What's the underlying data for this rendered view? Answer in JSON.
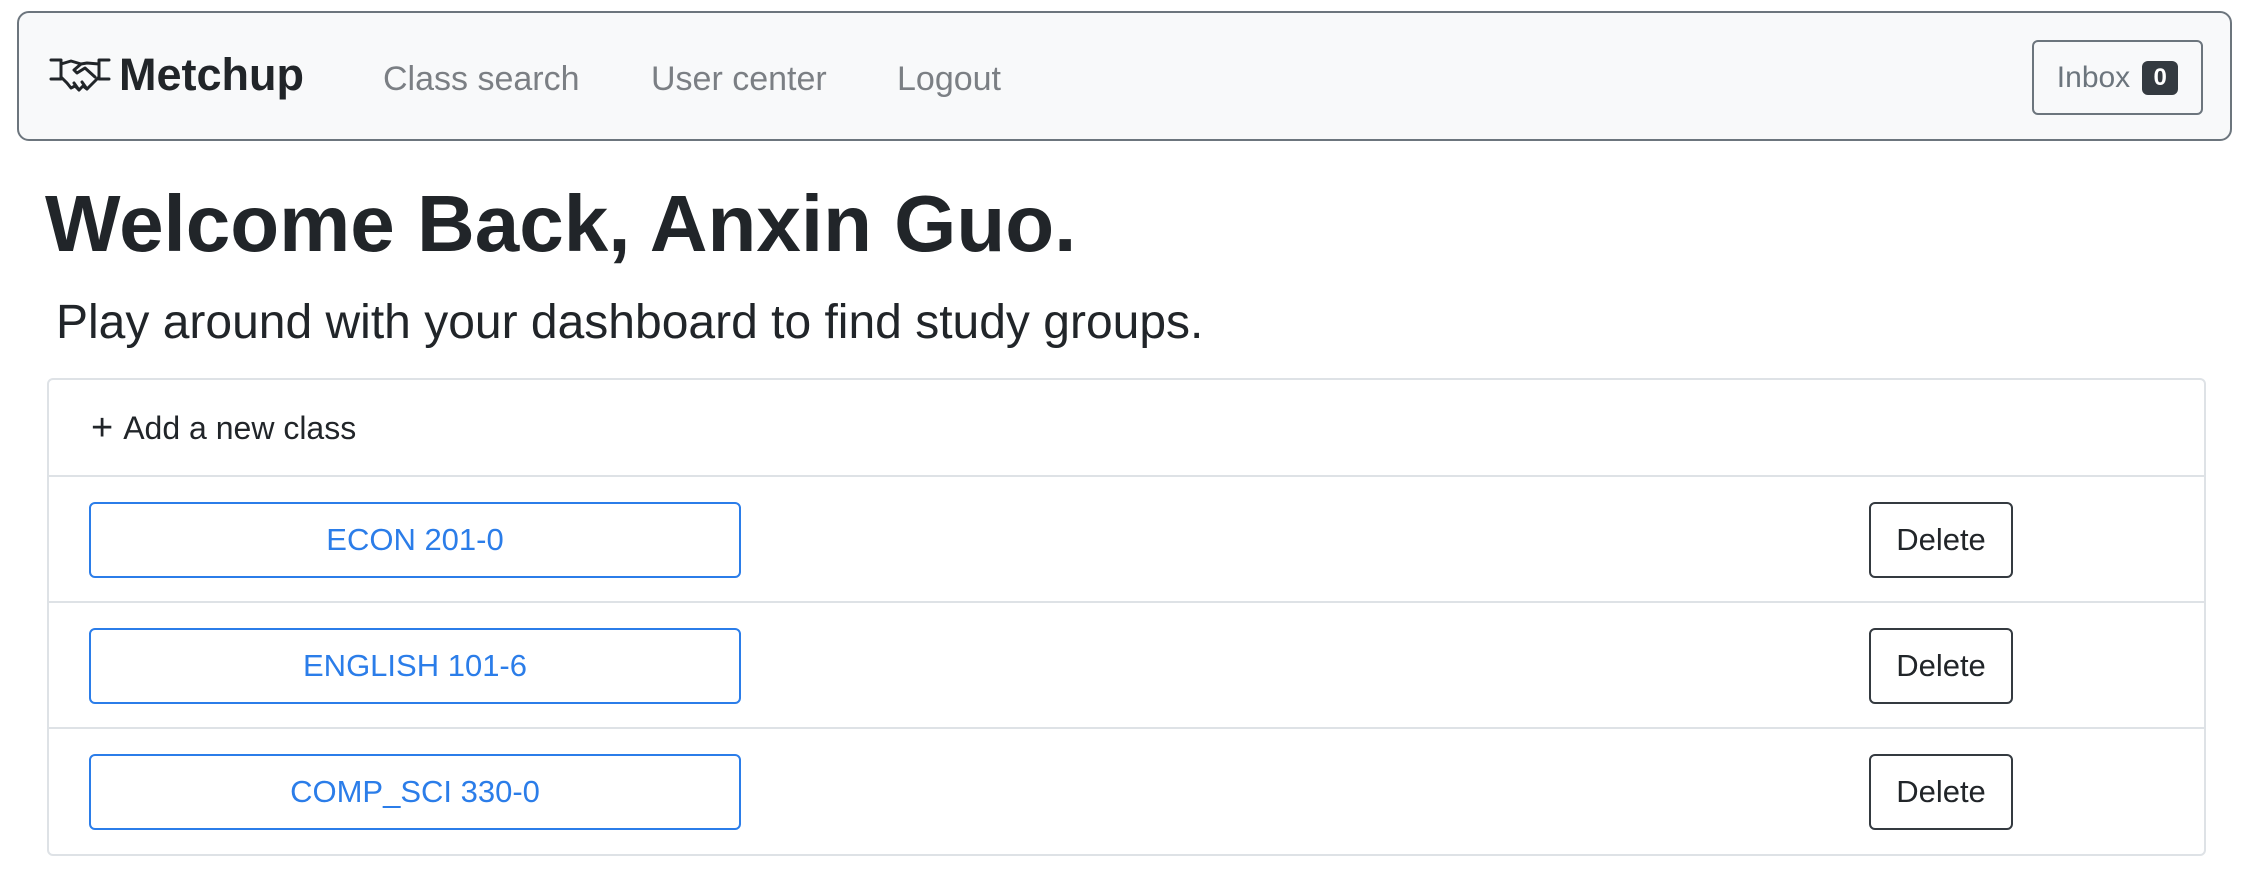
{
  "navbar": {
    "brand": {
      "icon": "handshake-icon",
      "label": "Metchup"
    },
    "links": [
      {
        "label": "Class search"
      },
      {
        "label": "User center"
      },
      {
        "label": "Logout"
      }
    ],
    "inbox": {
      "label": "Inbox",
      "count": "0"
    }
  },
  "main": {
    "title": "Welcome Back, Anxin Guo.",
    "subtitle": "Play around with your dashboard to find study groups.",
    "add_class": {
      "icon": "plus-icon",
      "label": "Add a new class"
    },
    "classes": [
      {
        "name": "ECON 201-0",
        "delete_label": "Delete"
      },
      {
        "name": "ENGLISH 101-6",
        "delete_label": "Delete"
      },
      {
        "name": "COMP_SCI 330-0",
        "delete_label": "Delete"
      }
    ]
  },
  "colors": {
    "primary": "#2b7de9",
    "navbar_bg": "#f8f9fa",
    "text": "#212529",
    "muted": "#7b7f84",
    "border": "#dee2e6"
  }
}
